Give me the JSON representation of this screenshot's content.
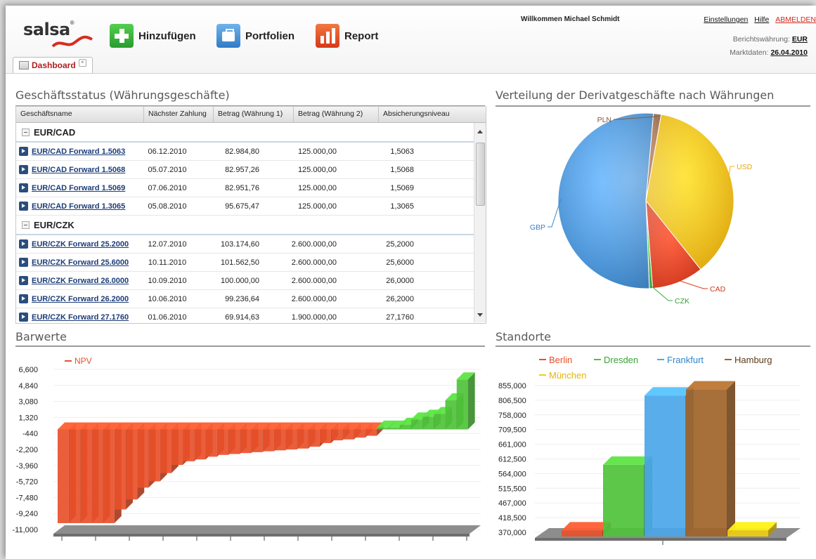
{
  "header": {
    "logo_text": "salsa",
    "logo_reg": "®",
    "toolbar": [
      {
        "label": "Hinzufügen",
        "icon": "plus-icon",
        "color": "#3ab54a"
      },
      {
        "label": "Portfolien",
        "icon": "briefcase-icon",
        "color": "#3a8fd6"
      },
      {
        "label": "Report",
        "icon": "bar-chart-icon",
        "color": "#e8502a"
      }
    ],
    "welcome": "Willkommen Michael Schmidt",
    "links": {
      "settings": "Einstellungen",
      "help": "Hilfe",
      "logout": "ABMELDEN"
    },
    "reporting_currency_label": "Berichtswährung:",
    "reporting_currency": "EUR",
    "market_data_label": "Marktdaten:",
    "market_data_date": "26.04.2010",
    "tab_label": "Dashboard"
  },
  "status_panel": {
    "title": "Geschäftsstatus (Währungsgeschäfte)",
    "columns": [
      "Geschäftsname",
      "Nächster Zahlung",
      "Betrag (Währung 1)",
      "Betrag (Währung 2)",
      "Absicherungsniveau"
    ],
    "groups": [
      {
        "name": "EUR/CAD",
        "rows": [
          [
            "EUR/CAD Forward 1.5063",
            "06.12.2010",
            "82.984,80",
            "125.000,00",
            "1,5063"
          ],
          [
            "EUR/CAD Forward 1.5068",
            "05.07.2010",
            "82.957,26",
            "125.000,00",
            "1,5068"
          ],
          [
            "EUR/CAD Forward 1.5069",
            "07.06.2010",
            "82.951,76",
            "125.000,00",
            "1,5069"
          ],
          [
            "EUR/CAD Forward 1.3065",
            "05.08.2010",
            "95.675,47",
            "125.000,00",
            "1,3065"
          ]
        ]
      },
      {
        "name": "EUR/CZK",
        "rows": [
          [
            "EUR/CZK Forward 25.2000",
            "12.07.2010",
            "103.174,60",
            "2.600.000,00",
            "25,2000"
          ],
          [
            "EUR/CZK Forward 25.6000",
            "10.11.2010",
            "101.562,50",
            "2.600.000,00",
            "25,6000"
          ],
          [
            "EUR/CZK Forward 26.0000",
            "10.09.2010",
            "100.000,00",
            "2.600.000,00",
            "26,0000"
          ],
          [
            "EUR/CZK Forward 26.2000",
            "10.06.2010",
            "99.236,64",
            "2.600.000,00",
            "26,2000"
          ],
          [
            "EUR/CZK Forward 27.1760",
            "01.06.2010",
            "69.914,63",
            "1.900.000,00",
            "27,1760"
          ]
        ]
      }
    ]
  },
  "pie_panel": {
    "title": "Verteilung der Derivatgeschäfte nach Währungen"
  },
  "npv_panel": {
    "title": "Barwerte"
  },
  "locations_panel": {
    "title": "Standorte"
  },
  "chart_data": [
    {
      "type": "pie",
      "categories": [
        "USD",
        "CAD",
        "CZK",
        "GBP",
        "PLN"
      ],
      "values": [
        36.5,
        9.5,
        0.6,
        52.0,
        1.4
      ],
      "colors": [
        "#f2b20d",
        "#dd3a1c",
        "#3aa93a",
        "#3a86cc",
        "#8a5a3a"
      ]
    },
    {
      "type": "bar",
      "series": [
        {
          "name": "NPV",
          "values": [
            -10300,
            -10300,
            -10300,
            -10300,
            -10300,
            -8800,
            -7700,
            -6400,
            -5700,
            -4800,
            -3900,
            -3500,
            -3300,
            -3000,
            -2800,
            -2700,
            -2600,
            -2500,
            -2400,
            -2300,
            -2200,
            -2100,
            -1900,
            -1500,
            -1200,
            -1100,
            -900,
            -700,
            200,
            200,
            500,
            1100,
            1400,
            1700,
            3200,
            5500
          ]
        }
      ],
      "ylabel": "",
      "ylim": [
        -11000,
        6600
      ],
      "yticks": [
        "6,600",
        "4,840",
        "3,080",
        "1,320",
        "-440",
        "-2,200",
        "-3,960",
        "-5,720",
        "-7,480",
        "-9,240",
        "-11,000"
      ],
      "colors": {
        "negative": "#e8502a",
        "positive": "#4fc23a"
      }
    },
    {
      "type": "bar",
      "series": [
        {
          "name": "Berlin",
          "values": [
            376000
          ]
        },
        {
          "name": "Dresden",
          "values": [
            593000
          ]
        },
        {
          "name": "Frankfurt",
          "values": [
            822000
          ]
        },
        {
          "name": "Hamburg",
          "values": [
            842000
          ]
        },
        {
          "name": "München",
          "values": [
            376000
          ]
        }
      ],
      "ylim": [
        370000,
        855000
      ],
      "yticks": [
        "855,000",
        "806,500",
        "758,000",
        "709,500",
        "661,000",
        "612,500",
        "564,000",
        "515,500",
        "467,000",
        "418,500",
        "370,000"
      ],
      "colors": [
        "#e8502a",
        "#4fc23a",
        "#4aa6e8",
        "#a0642a",
        "#f2cc12"
      ]
    }
  ]
}
